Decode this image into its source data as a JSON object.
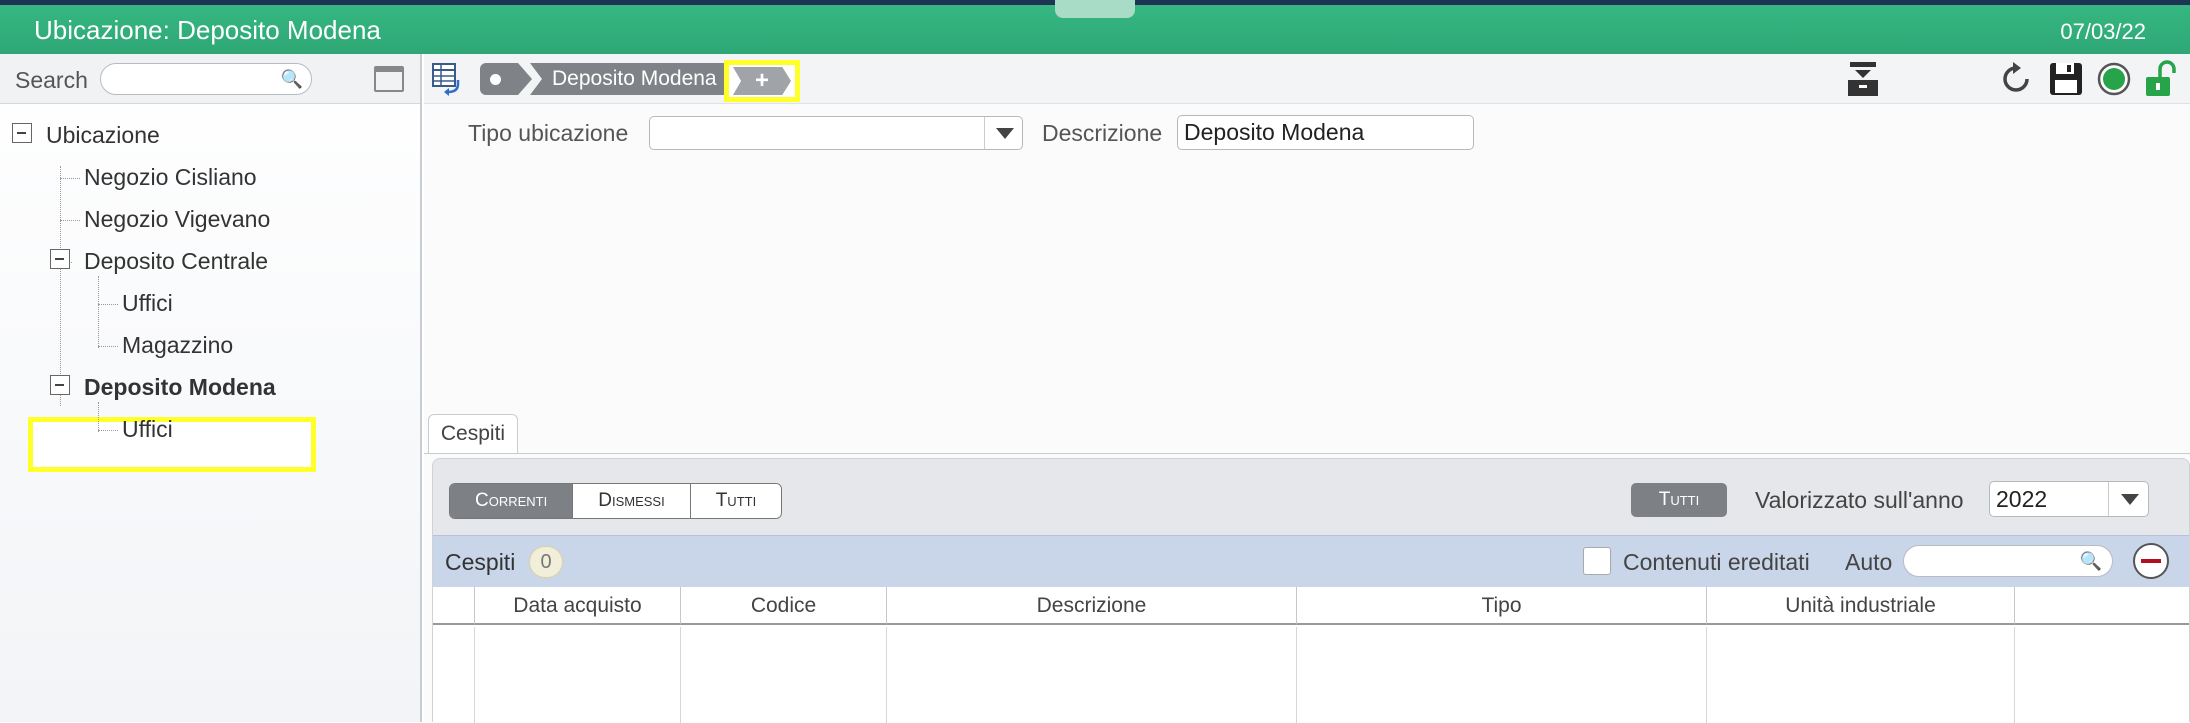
{
  "window": {
    "title": "Ubicazione: Deposito Modena",
    "date": "07/03/22"
  },
  "sidebar": {
    "search_label": "Search",
    "search_placeholder": "",
    "tree": [
      {
        "label": "Ubicazione",
        "expanded": true
      },
      {
        "label": "Negozio Cisliano"
      },
      {
        "label": "Negozio Vigevano"
      },
      {
        "label": "Deposito Centrale",
        "expanded": true
      },
      {
        "label": "Uffici"
      },
      {
        "label": "Magazzino"
      },
      {
        "label": "Deposito Modena",
        "expanded": true,
        "selected": true
      },
      {
        "label": "Uffici"
      }
    ]
  },
  "toolbar": {
    "breadcrumb": [
      "Deposito Modena"
    ],
    "add_child_label": "+",
    "icons": [
      "table-back-icon",
      "archive-icon",
      "refresh-icon",
      "save-icon",
      "status-green-icon",
      "unlock-icon"
    ]
  },
  "form": {
    "tipo_label": "Tipo ubicazione",
    "tipo_value": "",
    "descrizione_label": "Descrizione",
    "descrizione_value": "Deposito Modena"
  },
  "tabs": [
    "Cespiti"
  ],
  "cespiti": {
    "filter_options": [
      "Correnti",
      "Dismessi",
      "Tutti"
    ],
    "selected_filter": "Correnti",
    "tutti_button": "Tutti",
    "year_label": "Valorizzato sull'anno",
    "year_value": "2022",
    "grid_title": "Cespiti",
    "grid_count": "0",
    "inherited_label": "Contenuti ereditati",
    "auto_label": "Auto",
    "columns": [
      "Data acquisto",
      "Codice",
      "Descrizione",
      "Tipo",
      "Unità industriale"
    ]
  },
  "colors": {
    "titlebar": "#33b27e",
    "highlight": "#ffff2a",
    "selected_btn": "#7d8084"
  }
}
